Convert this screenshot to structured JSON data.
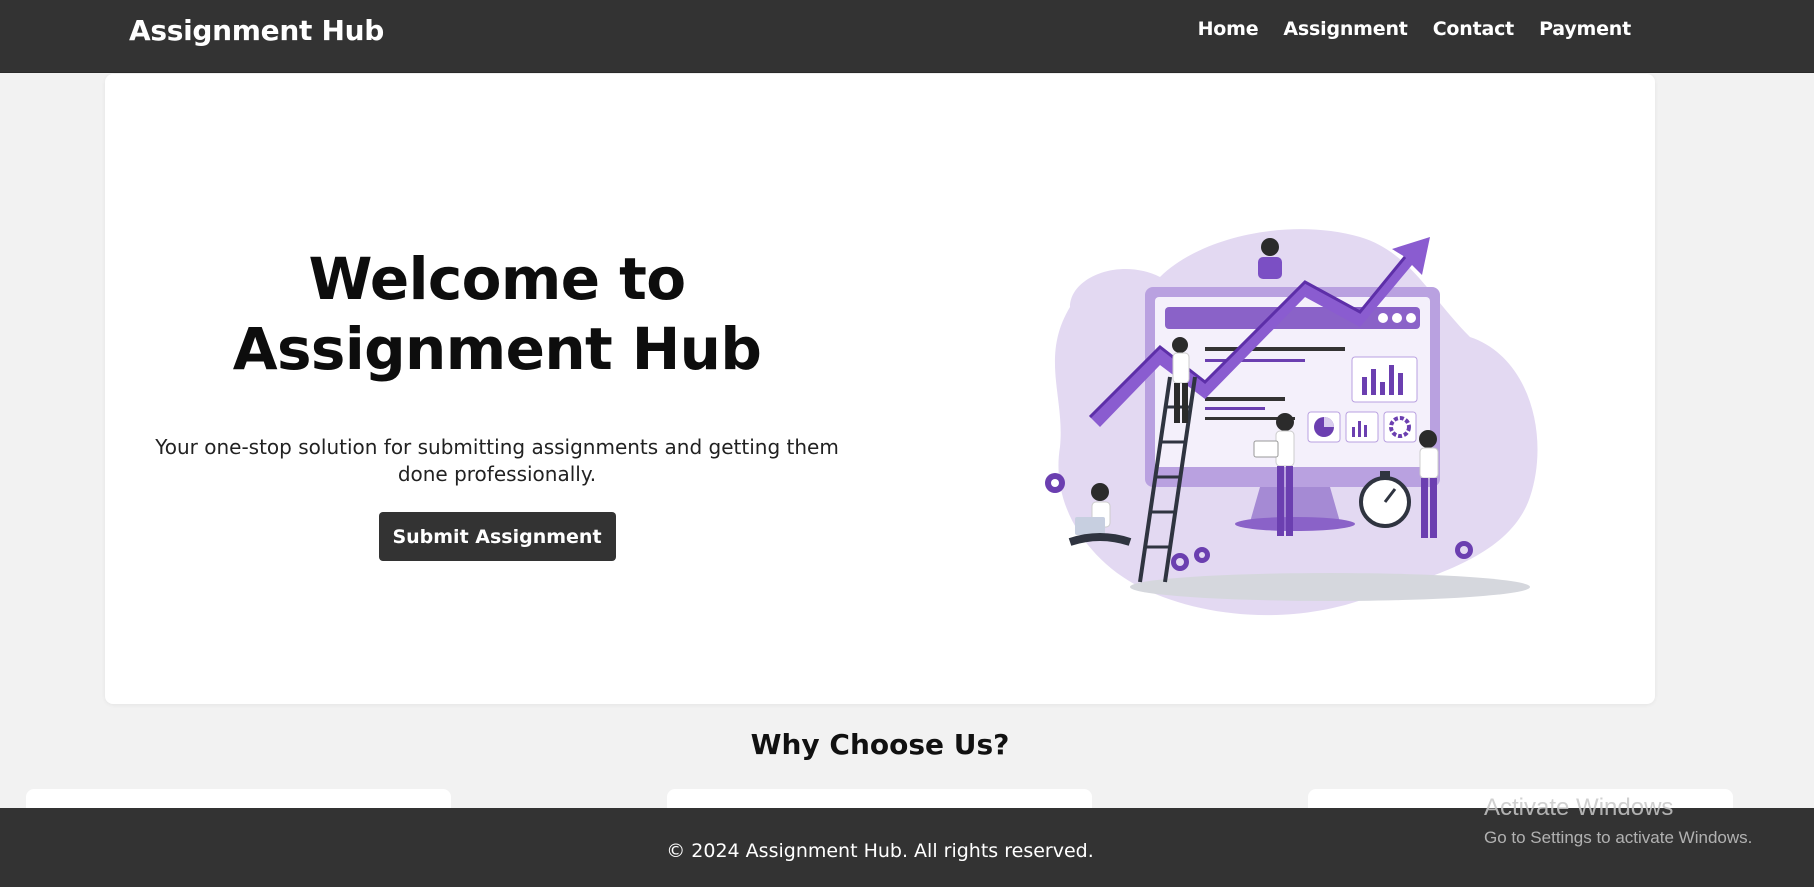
{
  "navbar": {
    "brand": "Assignment Hub",
    "links": [
      "Home",
      "Assignment",
      "Contact",
      "Payment"
    ]
  },
  "hero": {
    "title": "Welcome to Assignment Hub",
    "subtitle": "Your one-stop solution for submitting assignments and getting them done professionally.",
    "button_label": "Submit Assignment",
    "illustration_icon": "growth-analytics-illustration"
  },
  "why": {
    "title": "Why Choose Us?"
  },
  "footer": {
    "text": "© 2024 Assignment Hub. All rights reserved."
  },
  "watermark": {
    "title": "Activate Windows",
    "subtitle": "Go to Settings to activate Windows."
  },
  "colors": {
    "navbar_bg": "#333333",
    "page_bg": "#f2f2f2",
    "accent_purple": "#6b3fb0",
    "light_purple": "#d9cdee"
  }
}
